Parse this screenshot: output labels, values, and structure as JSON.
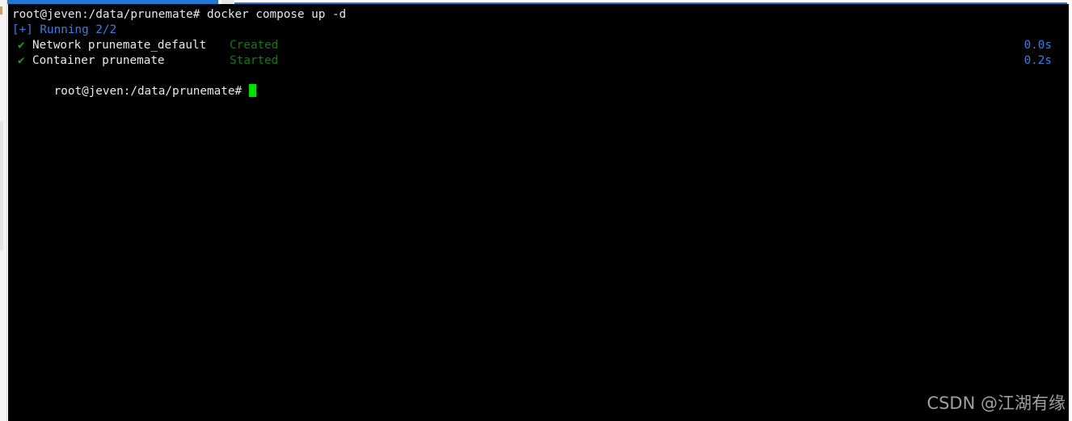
{
  "terminal": {
    "command_line": "root@jeven:/data/prunemate# docker compose up -d",
    "running_status": "[+] Running 2/2",
    "items": [
      {
        "check": "✔",
        "label": "Network prunemate_default",
        "status": "Created",
        "time": "0.0s"
      },
      {
        "check": "✔",
        "label": "Container prunemate",
        "status": "Started",
        "time": "0.2s"
      }
    ],
    "prompt": "root@jeven:/data/prunemate#"
  },
  "watermark": "CSDN @江湖有缘",
  "colors": {
    "background": "#000000",
    "text": "#e8e8e8",
    "running": "#3c7fe0",
    "check": "#1fa01f",
    "status": "#137a13",
    "cursor": "#00e000",
    "tab_accent": "#1f78d1"
  }
}
